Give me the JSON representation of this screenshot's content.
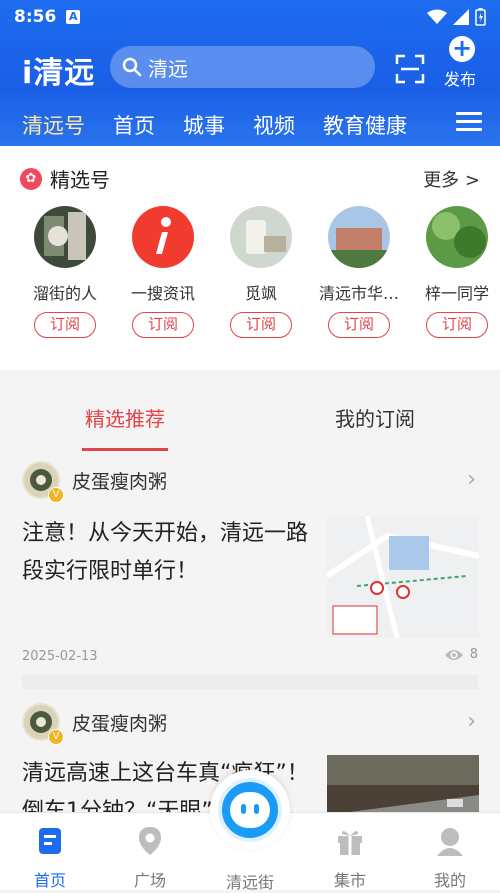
{
  "status": {
    "time": "8:56"
  },
  "header": {
    "logo": "i清远",
    "search_placeholder": "清远",
    "publish_label": "发布",
    "tabs": [
      "清远号",
      "首页",
      "城事",
      "视频",
      "教育健康"
    ]
  },
  "featured": {
    "title": "精选号",
    "more": "更多 >",
    "accounts": [
      {
        "name": "溜街的人",
        "button": "订阅"
      },
      {
        "name": "一搜资讯",
        "button": "订阅"
      },
      {
        "name": "觅飒",
        "button": "订阅"
      },
      {
        "name": "清远市华…",
        "button": "订阅"
      },
      {
        "name": "梓一同学",
        "button": "订阅"
      }
    ]
  },
  "feed": {
    "tabs": [
      "精选推荐",
      "我的订阅"
    ],
    "items": [
      {
        "author": "皮蛋瘦肉粥",
        "headline": "注意！从今天开始，清远一路段实行限时单行！",
        "date": "2025-02-13",
        "views": "8"
      },
      {
        "author": "皮蛋瘦肉粥",
        "headline": "清远高速上这台车真“疯狂”！倒车1分钟？“天眼”…"
      }
    ]
  },
  "bottom_nav": [
    "首页",
    "广场",
    "清远街",
    "集市",
    "我的"
  ],
  "colors": {
    "brand": "#1d6cf0",
    "accent": "#e0454a",
    "tab_active": "#ffe9a8"
  }
}
